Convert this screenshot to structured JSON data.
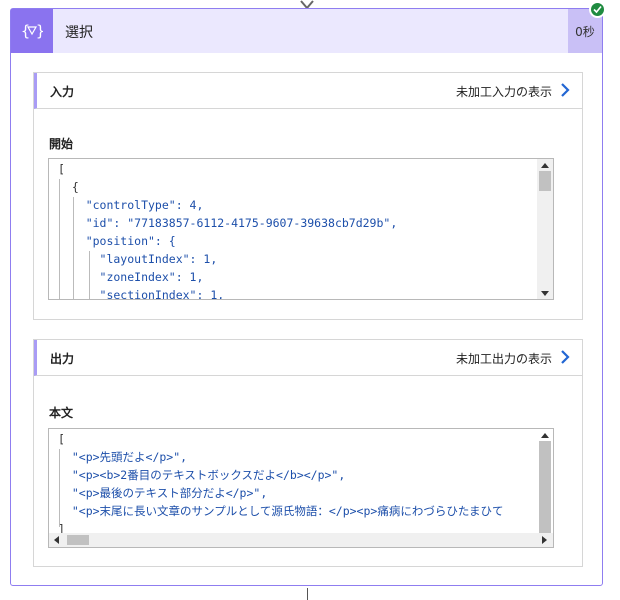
{
  "action": {
    "title": "選択",
    "duration": "0秒",
    "icon": "braces-filter-icon",
    "accent": "#8a73ef",
    "header_bg": "#ebe8fe"
  },
  "inputs": {
    "title": "入力",
    "raw_link": "未加工入力の表示",
    "field_label": "開始",
    "lines": [
      "[",
      "  {",
      "    \"controlType\": 4,",
      "    \"id\": \"77183857-6112-4175-9607-39638cb7d29b\",",
      "    \"position\": {",
      "      \"layoutIndex\": 1,",
      "      \"zoneIndex\": 1,",
      "      \"sectionIndex\": 1,"
    ]
  },
  "outputs": {
    "title": "出力",
    "raw_link": "未加工出力の表示",
    "field_label": "本文",
    "lines": [
      "[",
      "  \"<p>先頭だよ</p>\",",
      "  \"<p><b>2番目のテキストボックスだよ</b></p>\",",
      "  \"<p>最後のテキスト部分だよ</p>\",",
      "  \"<p>末尾に長い文章のサンプルとして源氏物語：</p><p>痛病にわづらひたまひて",
      "]"
    ]
  }
}
